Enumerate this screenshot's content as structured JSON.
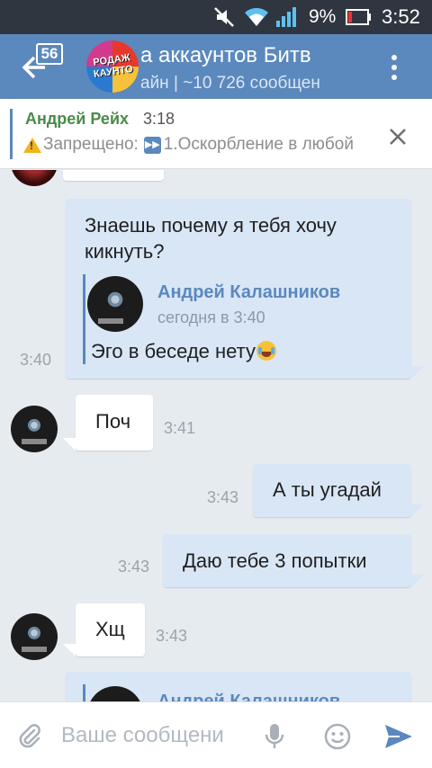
{
  "status_bar": {
    "battery_percent": "9%",
    "time": "3:52"
  },
  "header": {
    "unread_badge": "56",
    "avatar_text": "РОДАЖ\nКАУНТО",
    "title": "а аккаунтов Битв",
    "subtitle": "айн | ~10 726 сообщен"
  },
  "pinned": {
    "author": "Андрей Рейх",
    "time": "3:18",
    "text_prefix": "Запрещено:",
    "text_body": "1.Оскорбление в любой"
  },
  "messages": [
    {
      "direction": "out",
      "text_line1": "Знаешь почему я тебя хочу",
      "text_line2": "кикнуть?",
      "time": "3:40",
      "forward": {
        "name": "Андрей Калашников",
        "time": "сегодня в 3:40",
        "text": "Эго в беседе нету"
      }
    },
    {
      "direction": "in",
      "text": "Поч",
      "time": "3:41"
    },
    {
      "direction": "out",
      "text": "А ты угадай",
      "time": "3:43"
    },
    {
      "direction": "out",
      "text": "Даю тебе 3 попытки",
      "time": "3:43"
    },
    {
      "direction": "in",
      "text": "Хщ",
      "time": "3:43"
    },
    {
      "direction": "out",
      "forward": {
        "name": "Андрей Калашников"
      }
    }
  ],
  "input": {
    "placeholder": "Ваше сообщени",
    "value": ""
  },
  "icons": {
    "mute": "mute-icon",
    "wifi": "wifi-icon",
    "signal": "signal-icon",
    "battery": "battery-icon",
    "back": "back-arrow-icon",
    "more": "more-vertical-icon",
    "close": "close-icon",
    "attach": "paperclip-icon",
    "mic": "microphone-icon",
    "emoji": "emoji-icon",
    "send": "send-icon"
  },
  "colors": {
    "header": "#5b88bd",
    "status_bar": "#2f3640",
    "background": "#e6ebf0",
    "out_bubble": "#d9e6f6",
    "in_bubble": "#ffffff",
    "accent": "#5b88bd",
    "pinned_author": "#4a8b4a"
  }
}
